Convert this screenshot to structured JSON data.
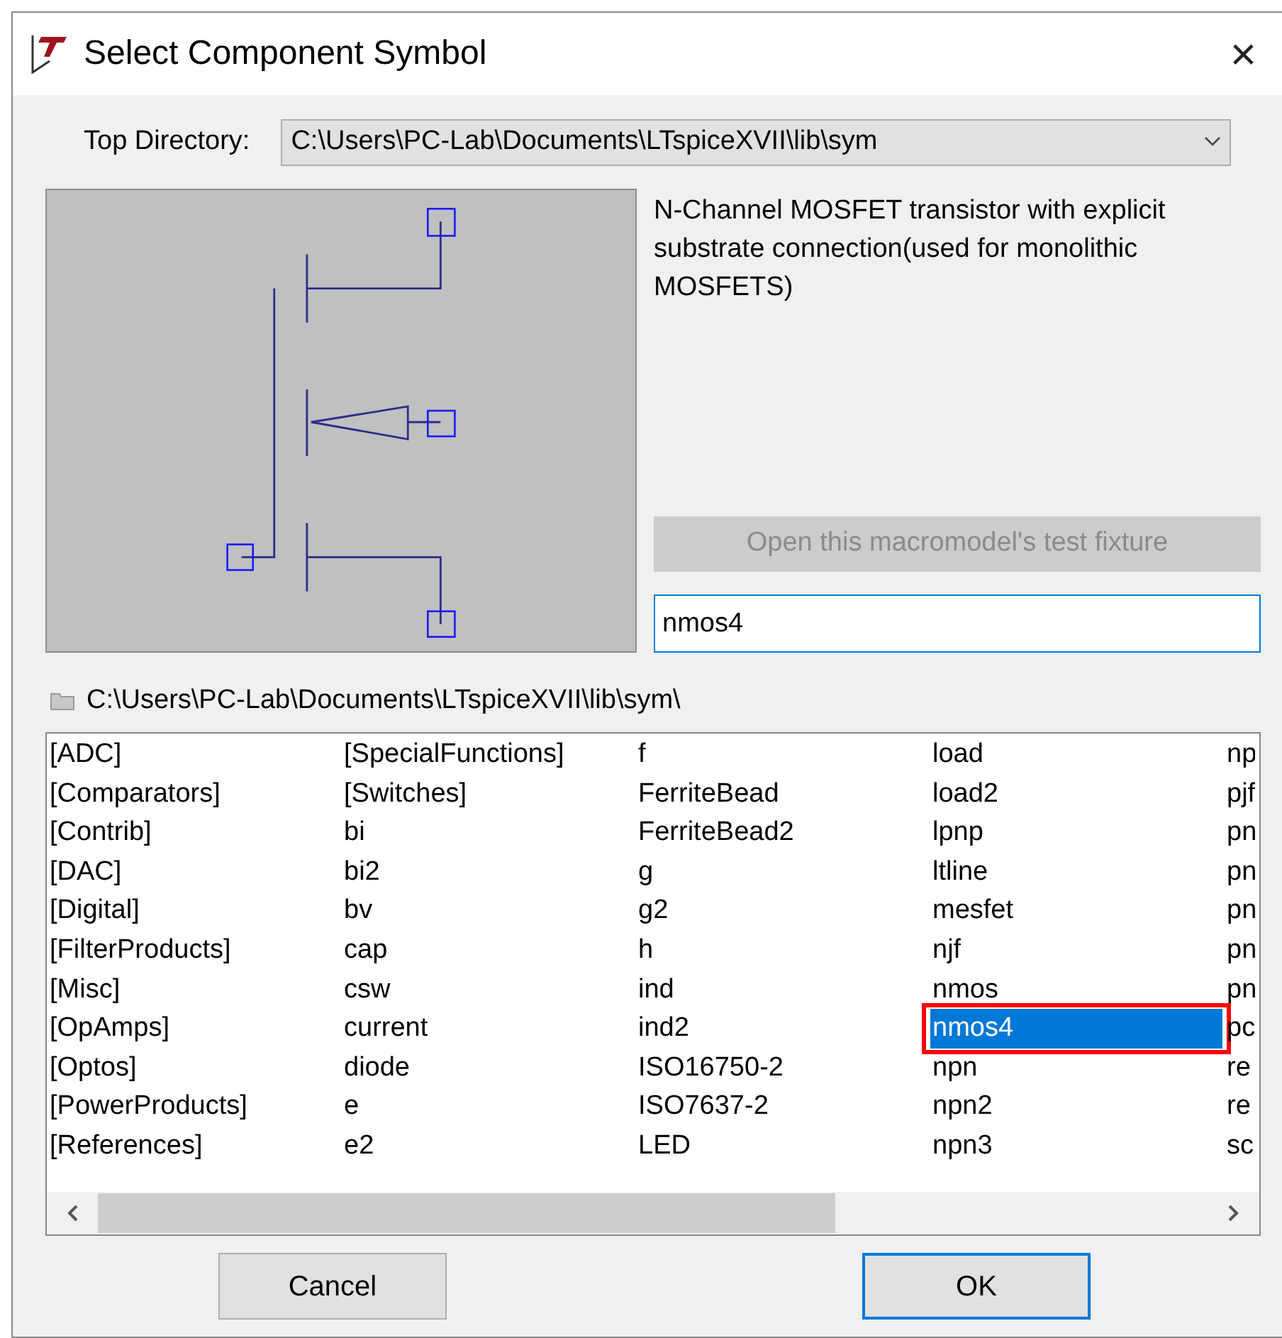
{
  "window": {
    "title": "Select Component Symbol",
    "close": "×"
  },
  "top_directory": {
    "label": "Top Directory:",
    "value": "C:\\Users\\PC-Lab\\Documents\\LTspiceXVII\\lib\\sym"
  },
  "description": "N-Channel MOSFET transistor with explicit substrate connection(used for monolithic MOSFETS)",
  "test_fixture_button": {
    "label": "Open this macromodel's test fixture",
    "disabled": true
  },
  "name_field": {
    "value": "nmos4"
  },
  "current_path": "C:\\Users\\PC-Lab\\Documents\\LTspiceXVII\\lib\\sym\\",
  "list": {
    "columns": [
      {
        "items": [
          {
            "label": "[ADC]",
            "selected": false
          },
          {
            "label": "[Comparators]",
            "selected": false
          },
          {
            "label": "[Contrib]",
            "selected": false
          },
          {
            "label": "[DAC]",
            "selected": false
          },
          {
            "label": "[Digital]",
            "selected": false
          },
          {
            "label": "[FilterProducts]",
            "selected": false
          },
          {
            "label": "[Misc]",
            "selected": false
          },
          {
            "label": "[OpAmps]",
            "selected": false
          },
          {
            "label": "[Optos]",
            "selected": false
          },
          {
            "label": "[PowerProducts]",
            "selected": false
          },
          {
            "label": "[References]",
            "selected": false
          }
        ]
      },
      {
        "items": [
          {
            "label": "[SpecialFunctions]",
            "selected": false
          },
          {
            "label": "[Switches]",
            "selected": false
          },
          {
            "label": "bi",
            "selected": false
          },
          {
            "label": "bi2",
            "selected": false
          },
          {
            "label": "bv",
            "selected": false
          },
          {
            "label": "cap",
            "selected": false
          },
          {
            "label": "csw",
            "selected": false
          },
          {
            "label": "current",
            "selected": false
          },
          {
            "label": "diode",
            "selected": false
          },
          {
            "label": "e",
            "selected": false
          },
          {
            "label": "e2",
            "selected": false
          }
        ]
      },
      {
        "items": [
          {
            "label": "f",
            "selected": false
          },
          {
            "label": "FerriteBead",
            "selected": false
          },
          {
            "label": "FerriteBead2",
            "selected": false
          },
          {
            "label": "g",
            "selected": false
          },
          {
            "label": "g2",
            "selected": false
          },
          {
            "label": "h",
            "selected": false
          },
          {
            "label": "ind",
            "selected": false
          },
          {
            "label": "ind2",
            "selected": false
          },
          {
            "label": "ISO16750-2",
            "selected": false
          },
          {
            "label": "ISO7637-2",
            "selected": false
          },
          {
            "label": "LED",
            "selected": false
          }
        ]
      },
      {
        "items": [
          {
            "label": "load",
            "selected": false
          },
          {
            "label": "load2",
            "selected": false
          },
          {
            "label": "lpnp",
            "selected": false
          },
          {
            "label": "ltline",
            "selected": false
          },
          {
            "label": "mesfet",
            "selected": false
          },
          {
            "label": "njf",
            "selected": false
          },
          {
            "label": "nmos",
            "selected": false
          },
          {
            "label": "nmos4",
            "selected": true,
            "outlined": true
          },
          {
            "label": "npn",
            "selected": false
          },
          {
            "label": "npn2",
            "selected": false
          },
          {
            "label": "npn3",
            "selected": false
          }
        ]
      },
      {
        "items": [
          {
            "label": "np",
            "selected": false
          },
          {
            "label": "pjf",
            "selected": false
          },
          {
            "label": "pn",
            "selected": false
          },
          {
            "label": "pn",
            "selected": false
          },
          {
            "label": "pn",
            "selected": false
          },
          {
            "label": "pn",
            "selected": false
          },
          {
            "label": "pn",
            "selected": false
          },
          {
            "label": "pc",
            "selected": false
          },
          {
            "label": "re",
            "selected": false
          },
          {
            "label": "re",
            "selected": false
          },
          {
            "label": "sc",
            "selected": false
          }
        ]
      }
    ]
  },
  "buttons": [
    {
      "label": "Cancel",
      "default": false
    },
    {
      "label": "OK",
      "default": true
    }
  ]
}
